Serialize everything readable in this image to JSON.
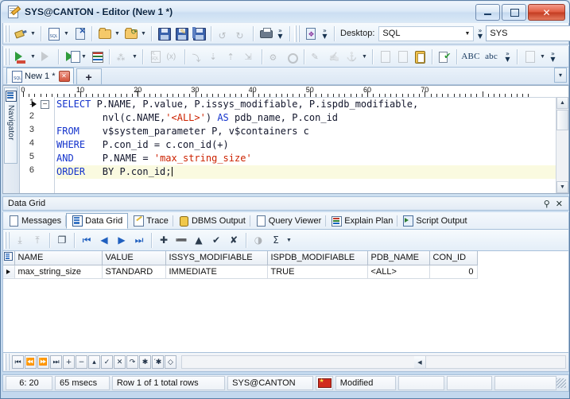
{
  "window": {
    "title": "SYS@CANTON - Editor (New 1 *)",
    "icon": "editor-document-pencil-icon",
    "buttons": {
      "minimize": "–",
      "maximize": "□",
      "close": "✕"
    }
  },
  "toolbar1": {
    "items": [
      {
        "name": "connect-plug",
        "icon": "plug-icon",
        "dropdown": true,
        "disabled": false
      },
      {
        "name": "new-sql-document",
        "icon": "sql-document-icon",
        "dropdown": true,
        "disabled": false
      },
      {
        "name": "disconnect",
        "icon": "disconnect-icon",
        "dropdown": false,
        "disabled": false
      },
      {
        "name": "open-file",
        "icon": "folder-open-icon",
        "dropdown": true,
        "disabled": false
      },
      {
        "name": "open-recent",
        "icon": "folder-arrow-icon",
        "dropdown": true,
        "disabled": false
      },
      {
        "name": "save",
        "icon": "save-icon",
        "dropdown": false,
        "disabled": false
      },
      {
        "name": "save-as",
        "icon": "save-as-icon",
        "dropdown": false,
        "disabled": false
      },
      {
        "name": "save-all",
        "icon": "save-all-icon",
        "dropdown": false,
        "disabled": false
      },
      {
        "name": "undo",
        "icon": "undo-icon",
        "dropdown": false,
        "disabled": true
      },
      {
        "name": "redo",
        "icon": "redo-icon",
        "dropdown": false,
        "disabled": true
      },
      {
        "name": "print",
        "icon": "printer-icon",
        "dropdown": false,
        "disabled": false
      }
    ],
    "overflow_label": "»",
    "session_browser": {
      "name": "session-browser",
      "icon": "session-browser-icon"
    },
    "desktop_label": "Desktop:",
    "desktop_value": "SQL",
    "connection_value": "SYS"
  },
  "toolbar2": {
    "items": [
      {
        "name": "execute-statement",
        "icon": "execute-icon",
        "dropdown": true,
        "disabled": false
      },
      {
        "name": "execute-batch",
        "icon": "execute-batch-icon",
        "dropdown": false,
        "disabled": true
      },
      {
        "name": "execute-as-script",
        "icon": "execute-script-icon",
        "dropdown": true,
        "disabled": false
      },
      {
        "name": "explain-plan",
        "icon": "explain-plan-icon",
        "dropdown": false,
        "disabled": false
      },
      {
        "name": "trace",
        "icon": "trace-icon",
        "dropdown": true,
        "disabled": true
      },
      {
        "name": "plsql-compile",
        "icon": "plsql-icon",
        "dropdown": false,
        "disabled": true
      },
      {
        "name": "variables",
        "icon": "variables-icon",
        "dropdown": false,
        "disabled": true
      },
      {
        "name": "step-into",
        "icon": "step-into-icon",
        "dropdown": false,
        "disabled": true
      },
      {
        "name": "step-over",
        "icon": "step-over-icon",
        "dropdown": false,
        "disabled": true
      },
      {
        "name": "step-out",
        "icon": "step-out-icon",
        "dropdown": false,
        "disabled": true
      },
      {
        "name": "run-to-cursor",
        "icon": "run-to-cursor-icon",
        "dropdown": false,
        "disabled": true
      },
      {
        "name": "debug-toggle",
        "icon": "debug-icon",
        "dropdown": false,
        "disabled": true
      },
      {
        "name": "breakpoint",
        "icon": "breakpoint-icon",
        "dropdown": false,
        "disabled": true
      },
      {
        "name": "format-code",
        "icon": "format-code-icon",
        "dropdown": false,
        "disabled": true
      },
      {
        "name": "beautify",
        "icon": "beautify-icon",
        "dropdown": false,
        "disabled": true
      },
      {
        "name": "step-debug-1",
        "icon": "debug-step-icon",
        "dropdown": false,
        "disabled": true
      },
      {
        "name": "step-debug-2",
        "icon": "debug-step2-icon",
        "dropdown": true,
        "disabled": true
      },
      {
        "name": "find-object",
        "icon": "find-object-icon",
        "dropdown": false,
        "disabled": true
      },
      {
        "name": "describe-object",
        "icon": "describe-object-icon",
        "dropdown": false,
        "disabled": true
      },
      {
        "name": "clipboard",
        "icon": "clipboard-icon",
        "dropdown": false,
        "disabled": false
      },
      {
        "name": "code-check",
        "icon": "code-check-icon",
        "dropdown": false,
        "disabled": false
      }
    ],
    "uppercase_label": "ABC",
    "lowercase_label": "abc",
    "overflow_label": "»",
    "last_button": {
      "name": "commit-options",
      "icon": "commit-icon"
    }
  },
  "editor_tabs": {
    "tabs": [
      {
        "label": "New 1 *",
        "icon": "sql-file-icon",
        "close": "✕",
        "active": true
      }
    ],
    "add_label": "+",
    "overflow_label": "▾"
  },
  "navigator": {
    "label": "Navigator",
    "icon": "navigator-list-icon"
  },
  "ruler": {
    "ticks": [
      "0",
      "10",
      "20",
      "30",
      "40",
      "50",
      "60",
      "70"
    ],
    "tab_marker": "T"
  },
  "code": {
    "lines": [
      {
        "n": "1",
        "segments": [
          {
            "t": "SELECT",
            "c": "kw"
          },
          {
            "t": " P.NAME, P.value, P.issys_modifiable, P.ispdb_modifiable,",
            "c": "pl"
          }
        ],
        "fold": "−",
        "current": true
      },
      {
        "n": "2",
        "segments": [
          {
            "t": "        nvl(c.NAME,",
            "c": "pl"
          },
          {
            "t": "'<ALL>'",
            "c": "str"
          },
          {
            "t": ") ",
            "c": "pl"
          },
          {
            "t": "AS",
            "c": "kw"
          },
          {
            "t": " pdb_name, P.con_id",
            "c": "pl"
          }
        ]
      },
      {
        "n": "3",
        "segments": [
          {
            "t": "FROM",
            "c": "kw"
          },
          {
            "t": "    v$system_parameter P, v$containers c",
            "c": "pl"
          }
        ]
      },
      {
        "n": "4",
        "segments": [
          {
            "t": "WHERE",
            "c": "kw"
          },
          {
            "t": "   P.con_id = c.con_id(+)",
            "c": "pl"
          }
        ]
      },
      {
        "n": "5",
        "segments": [
          {
            "t": "AND",
            "c": "kw"
          },
          {
            "t": "     P.NAME = ",
            "c": "pl"
          },
          {
            "t": "'max_string_size'",
            "c": "str"
          }
        ]
      },
      {
        "n": "6",
        "segments": [
          {
            "t": "ORDER",
            "c": "kw"
          },
          {
            "t": "   BY P.con_id;",
            "c": "pl"
          }
        ],
        "highlight": true,
        "caret": true
      }
    ]
  },
  "panel": {
    "title": "Data Grid",
    "pin_icon": "⚓",
    "close_icon": "✕"
  },
  "result_tabs": [
    {
      "label": "Messages",
      "icon": "messages-icon",
      "active": false
    },
    {
      "label": "Data Grid",
      "icon": "data-grid-icon",
      "active": true
    },
    {
      "label": "Trace",
      "icon": "trace-pen-icon",
      "active": false
    },
    {
      "label": "DBMS Output",
      "icon": "dbms-output-icon",
      "active": false
    },
    {
      "label": "Query Viewer",
      "icon": "query-viewer-icon",
      "active": false
    },
    {
      "label": "Explain Plan",
      "icon": "explain-plan-icon",
      "active": false
    },
    {
      "label": "Script Output",
      "icon": "script-output-icon",
      "active": false
    }
  ],
  "grid_toolbar": [
    {
      "name": "import-data",
      "icon": "import-icon",
      "disabled": true,
      "glyph": "⤓"
    },
    {
      "name": "export-data",
      "icon": "export-icon",
      "disabled": true,
      "glyph": "⤒"
    },
    {
      "name": "copy-data",
      "icon": "copy-data-icon",
      "disabled": false,
      "glyph": "❐"
    },
    {
      "name": "first-record",
      "icon": "first-record-icon",
      "disabled": false,
      "glyph": "⏮"
    },
    {
      "name": "previous-record",
      "icon": "previous-record-icon",
      "disabled": false,
      "glyph": "◀"
    },
    {
      "name": "next-record",
      "icon": "next-record-icon",
      "disabled": false,
      "glyph": "▶"
    },
    {
      "name": "last-record",
      "icon": "last-record-icon",
      "disabled": false,
      "glyph": "⏭"
    },
    {
      "name": "insert-record",
      "icon": "plus-icon",
      "disabled": false,
      "glyph": "✚"
    },
    {
      "name": "delete-record",
      "icon": "minus-icon",
      "disabled": false,
      "glyph": "➖"
    },
    {
      "name": "edit-record",
      "icon": "triangle-up-icon",
      "disabled": false,
      "glyph": "▲"
    },
    {
      "name": "post-edit",
      "icon": "check-icon",
      "disabled": false,
      "glyph": "✔"
    },
    {
      "name": "cancel-edit",
      "icon": "cancel-icon",
      "disabled": false,
      "glyph": "✘"
    },
    {
      "name": "refresh-data",
      "icon": "refresh-icon",
      "disabled": true,
      "glyph": "◑"
    },
    {
      "name": "aggregate-sum",
      "icon": "sigma-icon",
      "disabled": false,
      "glyph": "Σ"
    }
  ],
  "data_grid": {
    "columns": [
      "NAME",
      "VALUE",
      "ISSYS_MODIFIABLE",
      "ISPDB_MODIFIABLE",
      "PDB_NAME",
      "CON_ID"
    ],
    "rows": [
      {
        "marker": "▶",
        "cells": [
          "max_string_size",
          "STANDARD",
          "IMMEDIATE",
          "TRUE",
          "<ALL>",
          "0"
        ]
      }
    ],
    "corner_icon": "grid-select-all-icon"
  },
  "grid_nav": {
    "buttons": [
      {
        "name": "nav-first",
        "glyph": "⏮"
      },
      {
        "name": "nav-prior-page",
        "glyph": "⏪"
      },
      {
        "name": "nav-next-page",
        "glyph": "⏩"
      },
      {
        "name": "nav-last",
        "glyph": "⏭"
      },
      {
        "name": "nav-insert",
        "glyph": "+"
      },
      {
        "name": "nav-delete",
        "glyph": "−"
      },
      {
        "name": "nav-edit",
        "glyph": "▴"
      },
      {
        "name": "nav-post",
        "glyph": "✓"
      },
      {
        "name": "nav-cancel",
        "glyph": "✕"
      },
      {
        "name": "nav-refresh",
        "glyph": "↷"
      },
      {
        "name": "nav-asterisk",
        "glyph": "✱"
      },
      {
        "name": "nav-asterisk-quote",
        "glyph": "′✱"
      },
      {
        "name": "nav-clear",
        "glyph": "◇"
      }
    ],
    "scroll_left_glyph": "◀"
  },
  "status_bar": {
    "cursor_position": "6:  20",
    "elapsed": "65 msecs",
    "row_status": "Row 1 of 1 total rows",
    "session": "SYS@CANTON",
    "flag_icon": "country-flag-icon",
    "modified": "Modified"
  }
}
